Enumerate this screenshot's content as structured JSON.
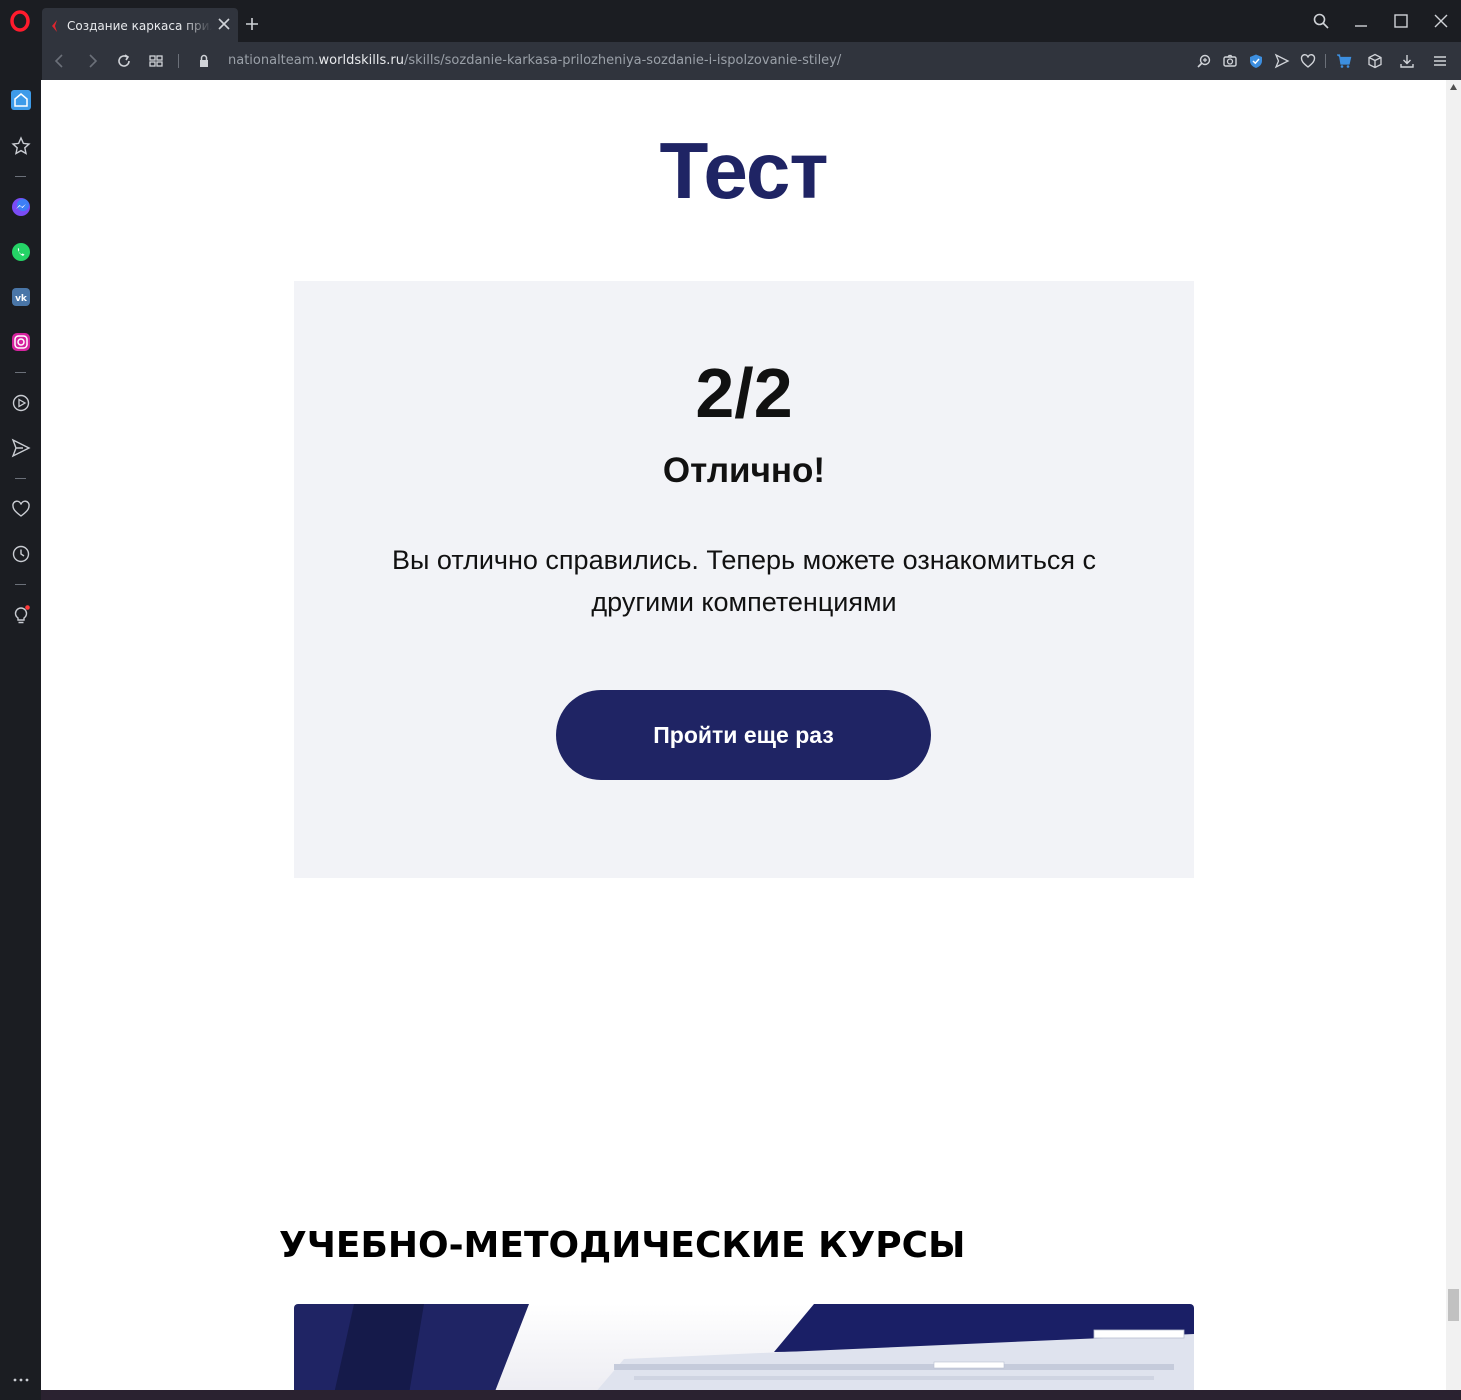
{
  "browser": {
    "tab_title": "Создание каркаса прилож",
    "url_prefix": "nationalteam.",
    "url_host": "worldskills.ru",
    "url_path": "/skills/sozdanie-karkasa-prilozheniya-sozdanie-i-ispolzovanie-stiley/"
  },
  "sidebar": {
    "items": [
      "home-icon",
      "star-icon",
      "messenger-icon",
      "whatsapp-icon",
      "vk-icon",
      "instagram-icon",
      "player-icon",
      "send-icon",
      "heart-icon",
      "history-icon",
      "lightbulb-icon",
      "more-icon"
    ]
  },
  "page": {
    "title": "Тест",
    "result": {
      "score": "2/2",
      "verdict": "Отлично!",
      "message": "Вы отлично справились. Теперь можете ознакомиться с другими компетенциями",
      "retry_label": "Пройти еще раз"
    },
    "courses_heading": "УЧЕБНО-МЕТОДИЧЕСКИЕ КУРСЫ"
  },
  "colors": {
    "brand": "#1f2464",
    "card_bg": "#f2f3f7",
    "chrome_bg": "#1b1d22",
    "opera_red": "#ff1b2d",
    "accent_blue": "#3d8fe0"
  }
}
